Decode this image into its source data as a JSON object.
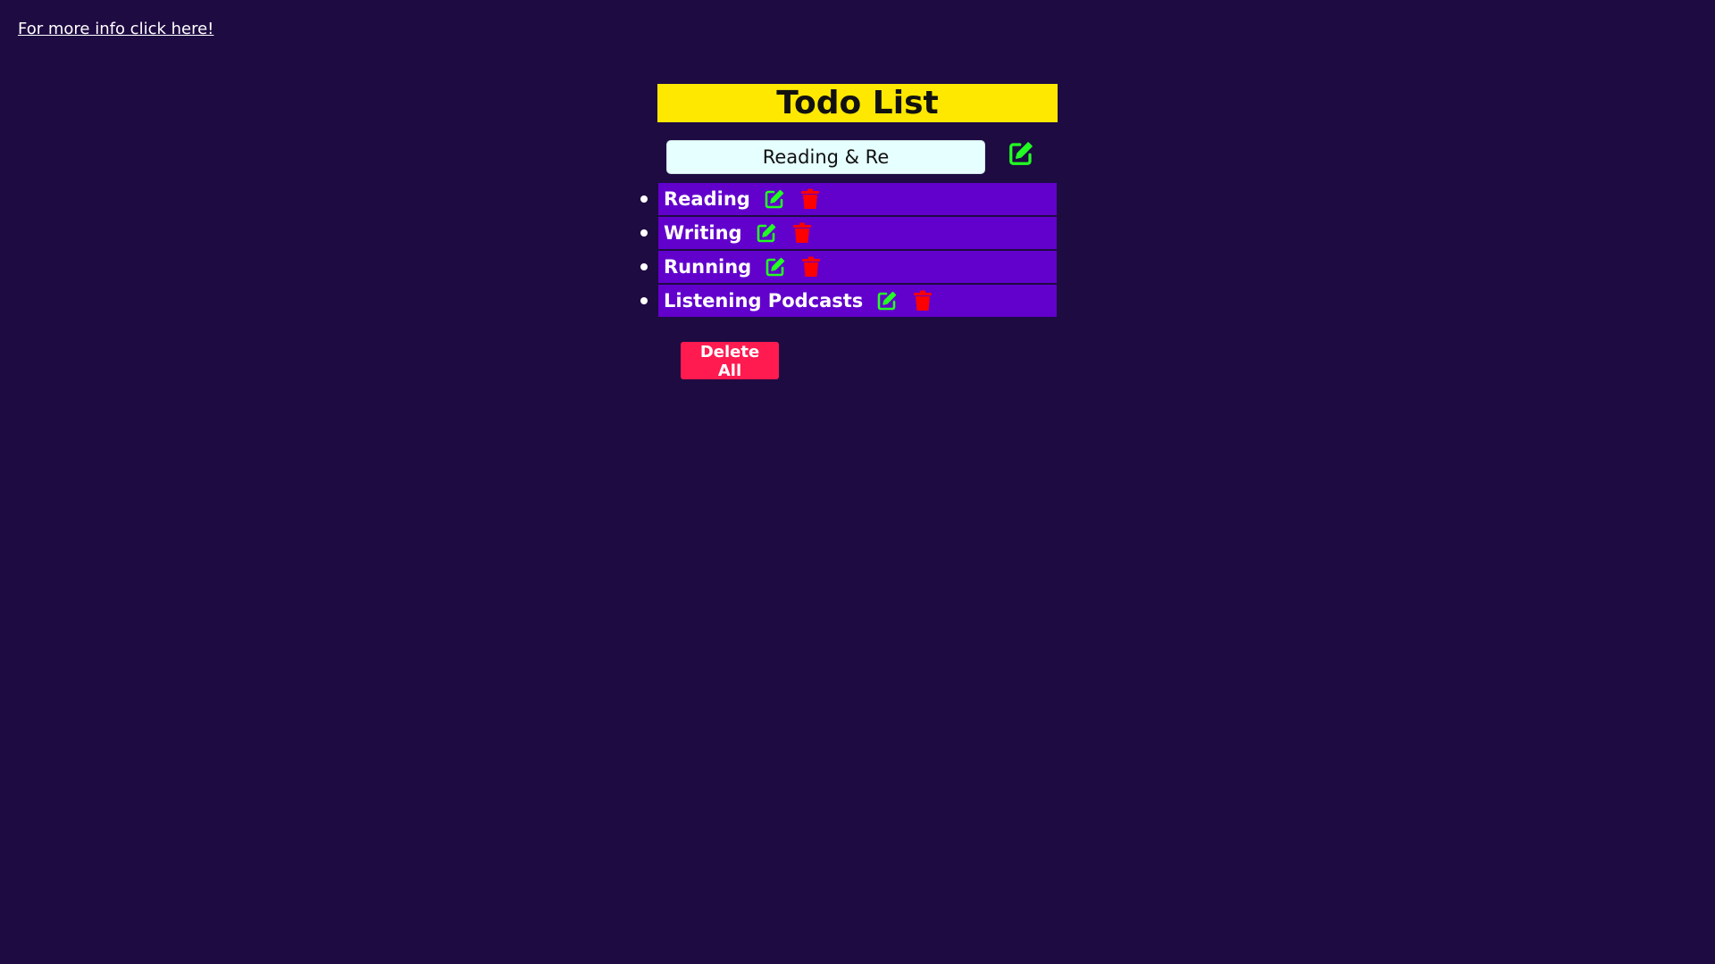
{
  "header": {
    "info_link": "For more info click here!"
  },
  "app": {
    "title": "Todo List"
  },
  "editor": {
    "value": "Reading & Re",
    "submit_icon": "edit-icon"
  },
  "todos": [
    {
      "label": "Reading",
      "edit_icon": "edit-icon",
      "delete_icon": "trash-icon"
    },
    {
      "label": "Writing",
      "edit_icon": "edit-icon",
      "delete_icon": "trash-icon"
    },
    {
      "label": "Running",
      "edit_icon": "edit-icon",
      "delete_icon": "trash-icon"
    },
    {
      "label": "Listening Podcasts",
      "edit_icon": "edit-icon",
      "delete_icon": "trash-icon"
    }
  ],
  "actions": {
    "delete_all_label": "Delete All"
  },
  "colors": {
    "background": "#1e0b42",
    "title_bar": "#ffe800",
    "item_bg": "#6200cc",
    "edit_icon": "#22ff22",
    "delete_icon": "#ff0000",
    "delete_all": "#ff1a4f"
  }
}
